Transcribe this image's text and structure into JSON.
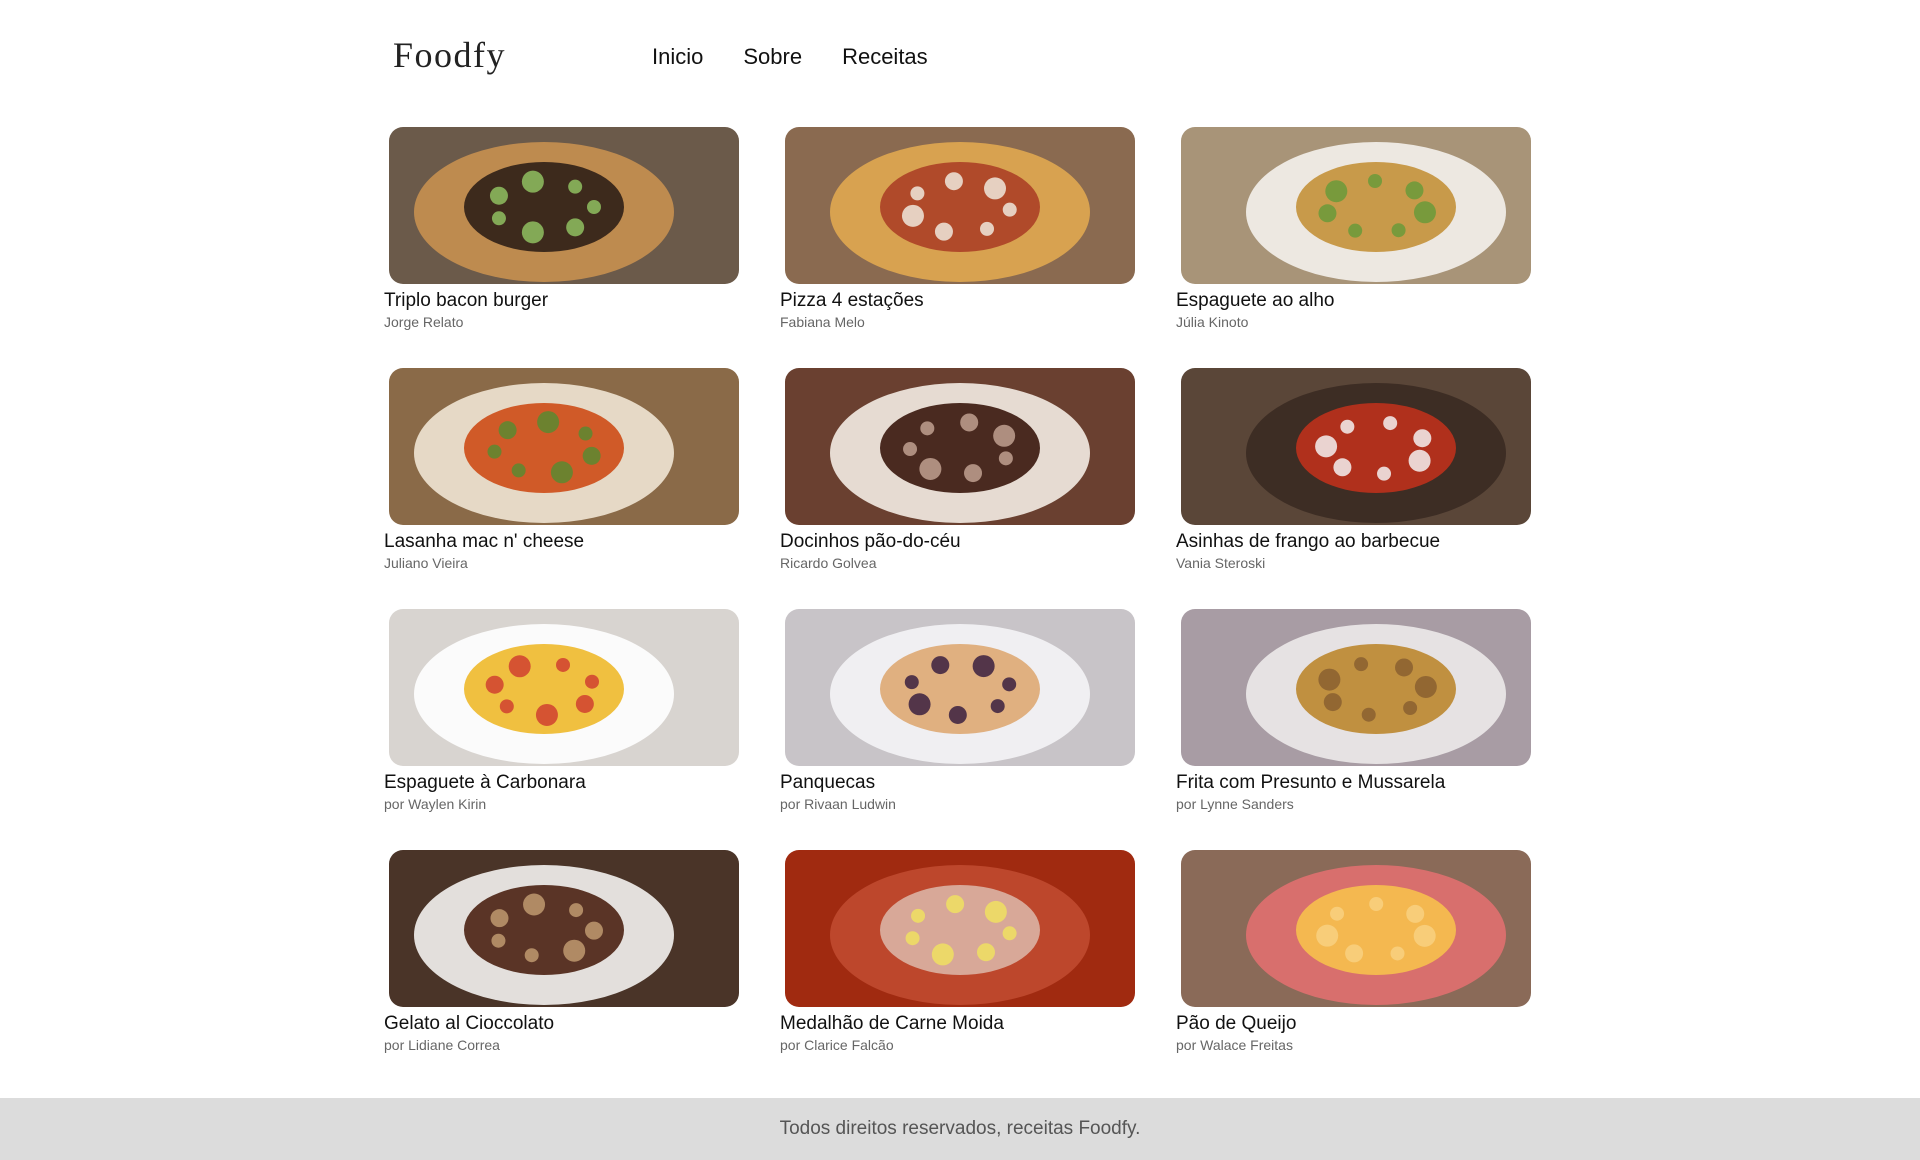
{
  "header": {
    "logo": "Foodfy",
    "nav": [
      "Inicio",
      "Sobre",
      "Receitas"
    ]
  },
  "recipes": [
    {
      "title": "Triplo bacon burger",
      "author": "Jorge Relato",
      "image": "burger-photo",
      "colors": [
        "#6b5a4a",
        "#c89050",
        "#3d2a1c",
        "#8fbf60"
      ]
    },
    {
      "title": "Pizza 4 estações",
      "author": "Fabiana Melo",
      "image": "pizza-photo",
      "colors": [
        "#8a6a50",
        "#e0a850",
        "#b04a2a",
        "#f0e8dc"
      ]
    },
    {
      "title": "Espaguete ao alho",
      "author": "Júlia Kinoto",
      "image": "spaghetti-garlic-photo",
      "colors": [
        "#a89478",
        "#f4f1ec",
        "#c89a4a",
        "#6a9a3a"
      ]
    },
    {
      "title": "Lasanha mac n' cheese",
      "author": "Juliano Vieira",
      "image": "lasagna-photo",
      "colors": [
        "#8a6a48",
        "#f0e6d4",
        "#d05a28",
        "#5a8a30"
      ]
    },
    {
      "title": "Docinhos pão-do-céu",
      "author": "Ricardo Golvea",
      "image": "chocolates-photo",
      "colors": [
        "#6a4030",
        "#f4ece4",
        "#4a2a20",
        "#c0a090"
      ]
    },
    {
      "title": "Asinhas de frango ao barbecue",
      "author": "Vania Steroski",
      "image": "chicken-wings-photo",
      "colors": [
        "#5a4638",
        "#3a2a22",
        "#b0301c",
        "#f4f0f0"
      ]
    },
    {
      "title": "Espaguete à Carbonara",
      "author": "por Waylen Kirin",
      "image": "carbonara-photo",
      "colors": [
        "#d8d4d0",
        "#ffffff",
        "#f0c040",
        "#d04030"
      ]
    },
    {
      "title": "Panquecas",
      "author": "por Rivaan Ludwin",
      "image": "pancakes-photo",
      "colors": [
        "#c8c4c8",
        "#f4f4f6",
        "#e0b080",
        "#3a2040"
      ]
    },
    {
      "title": "Frita com Presunto e Mussarela",
      "author": "por Lynne Sanders",
      "image": "omelette-photo",
      "colors": [
        "#a89ca4",
        "#eceaea",
        "#c09040",
        "#8a6030"
      ]
    },
    {
      "title": "Gelato al Cioccolato",
      "author": "por Lidiane Correa",
      "image": "gelato-photo",
      "colors": [
        "#4a3428",
        "#f4f2f0",
        "#5a3426",
        "#c09a70"
      ]
    },
    {
      "title": "Medalhão de Carne Moida",
      "author": "por Clarice Falcão",
      "image": "meat-medallion-photo",
      "colors": [
        "#a02a10",
        "#c04a30",
        "#d8a898",
        "#f0e060"
      ]
    },
    {
      "title": "Pão de Queijo",
      "author": "por Walace Freitas",
      "image": "cheese-bread-photo",
      "colors": [
        "#8a6a58",
        "#e07070",
        "#f4b850",
        "#f8d080"
      ]
    }
  ],
  "footer": {
    "text": "Todos direitos reservados, receitas Foodfy."
  }
}
